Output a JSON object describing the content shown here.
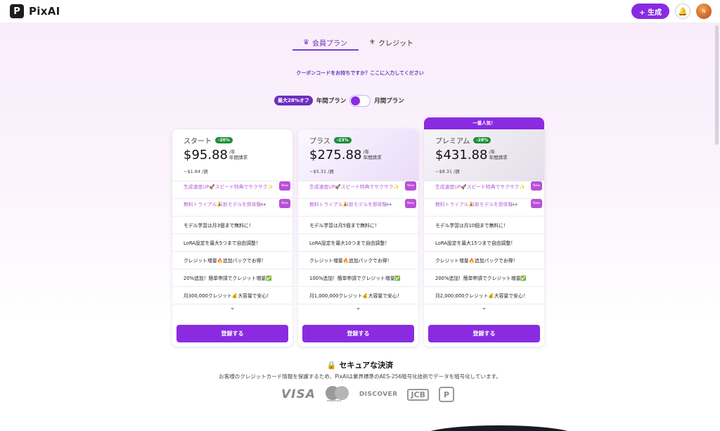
{
  "header": {
    "logo_letter": "P",
    "app_name": "PixAI",
    "generate_label": "+ 生成",
    "avatar_initial": "N"
  },
  "tabs": [
    {
      "label": "会員プラン",
      "icon": "crown-icon",
      "active": true
    },
    {
      "label": "クレジット",
      "icon": "credit-icon",
      "active": false
    }
  ],
  "coupon_text": "クーポンコードをお持ちですか？ここに入力してください",
  "period": {
    "discount_badge": "最大28%オフ",
    "yearly_label": "年間プラン",
    "monthly_label": "月間プラン",
    "selected": "yearly"
  },
  "popular_label": "一番人気！",
  "plans": [
    {
      "name": "スタート",
      "discount": "-20%",
      "price": "$95.88",
      "per": "/年",
      "billing": "年間請求",
      "weekly": "~$1.84 /週",
      "features": [
        {
          "text": "生成速度UP🚀スピード特典でサクサク✨",
          "new": "New",
          "highlight": true
        },
        {
          "text": "無料トライアル🎉新モデルを即体験👀",
          "new": "New",
          "highlight": true
        },
        {
          "text": "モデル学習は月3個まで無料に！"
        },
        {
          "text": "LoRA設定を最大5つまで自由調整！"
        },
        {
          "text": "クレジット増量🔥追加パックでお得！"
        },
        {
          "text": "20%追加！簡単申請でクレジット増量✅"
        },
        {
          "text": "月300,000クレジット💰大容量で安心！"
        }
      ],
      "cta": "登録する"
    },
    {
      "name": "プラス",
      "discount": "-23%",
      "price": "$275.88",
      "per": "/年",
      "billing": "年間請求",
      "weekly": "~$5.31 /週",
      "features": [
        {
          "text": "生成速度UP🚀スピード特典でサクサク✨",
          "new": "New",
          "highlight": true
        },
        {
          "text": "無料トライアル🎉新モデルを即体験👀",
          "new": "New",
          "highlight": true
        },
        {
          "text": "モデル学習は月5個まで無料に！"
        },
        {
          "text": "LoRA設定を最大10つまで自由調整！"
        },
        {
          "text": "クレジット増量🔥追加パックでお得！"
        },
        {
          "text": "100%追加！簡単申請でクレジット増量✅"
        },
        {
          "text": "月1,000,000クレジット💰大容量で安心！"
        }
      ],
      "cta": "登録する"
    },
    {
      "name": "プレミアム",
      "discount": "-28%",
      "price": "$431.88",
      "per": "/年",
      "billing": "年間請求",
      "weekly": "~$8.31 /週",
      "features": [
        {
          "text": "生成速度UP🚀スピード特典でサクサク✨",
          "new": "New",
          "highlight": true
        },
        {
          "text": "無料トライアル🎉新モデルを即体験👀",
          "new": "New",
          "highlight": true
        },
        {
          "text": "モデル学習は月10個まで無料に！"
        },
        {
          "text": "LoRA設定を最大15つまで自由調整！"
        },
        {
          "text": "クレジット増量🔥追加パックでお得！"
        },
        {
          "text": "200%追加！簡単申請でクレジット増量✅"
        },
        {
          "text": "月2,000,000クレジット💰大容量で安心！"
        }
      ],
      "cta": "登録する"
    }
  ],
  "secure": {
    "title": "セキュアな決済",
    "text": "お客様のクレジットカード情報を保護するため、PixAIは業界標準のAES-256暗号化技術でデータを暗号化しています。"
  },
  "payment_logos": {
    "visa": "VISA",
    "mastercard": "mastercard",
    "discover": "DISCOVER",
    "jcb": "JCB",
    "paypay": "P"
  },
  "colors": {
    "accent": "#8a2be2",
    "discount_green": "#1e8f3a",
    "highlight_text": "#b35fd6"
  }
}
